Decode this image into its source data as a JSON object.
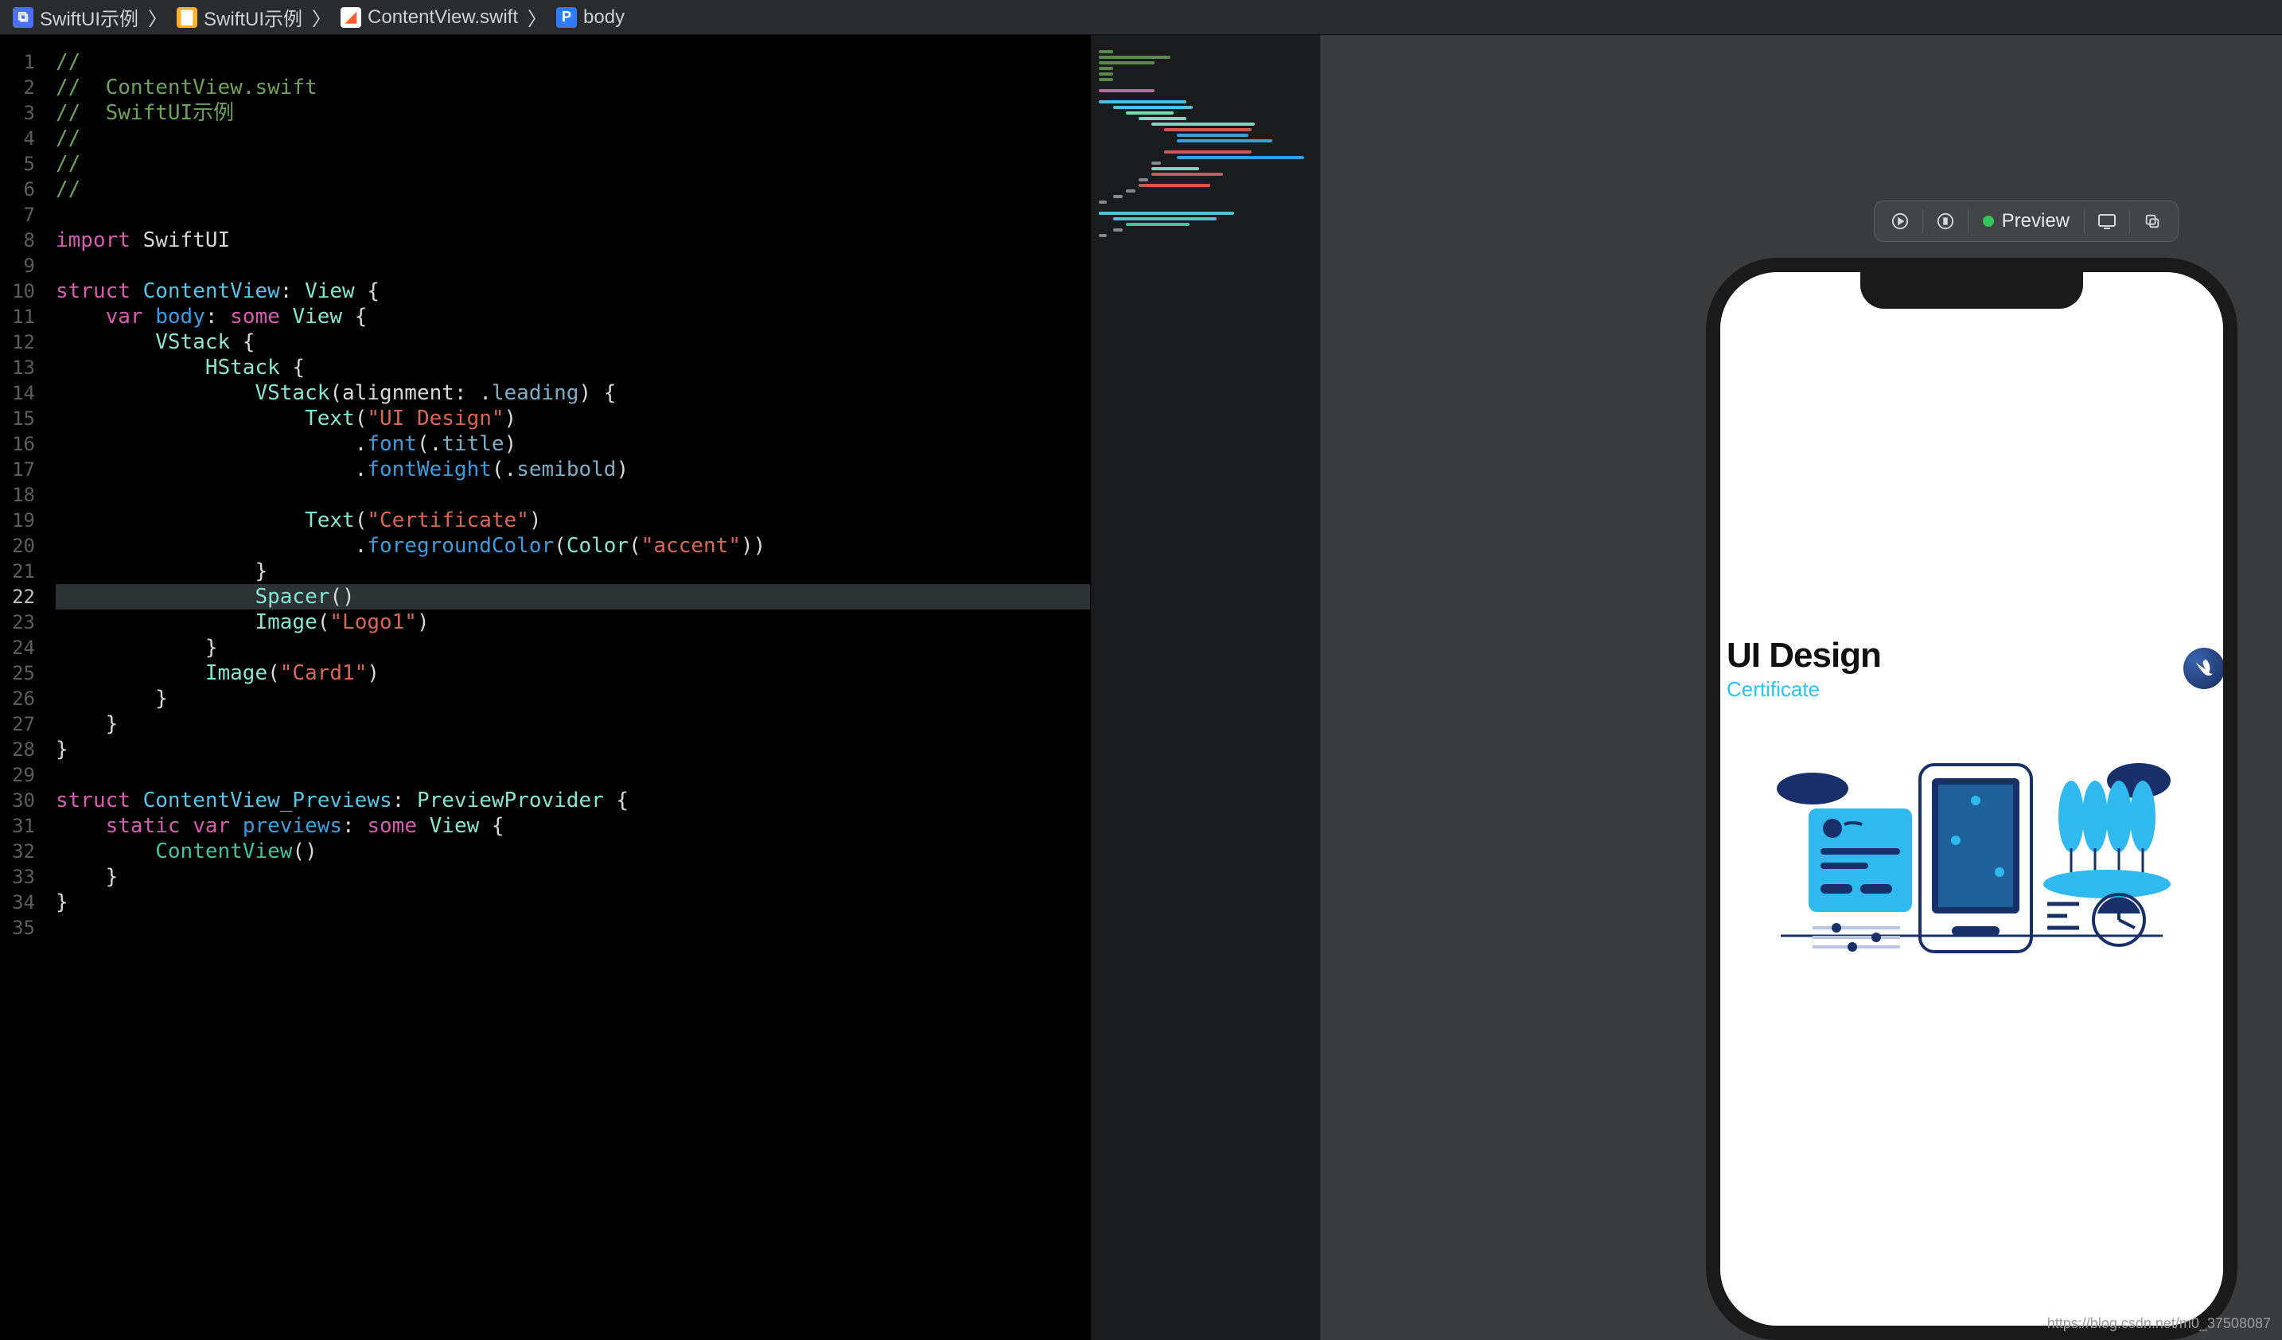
{
  "breadcrumb": {
    "project": "SwiftUI示例",
    "folder": "SwiftUI示例",
    "file": "ContentView.swift",
    "symbol": "body"
  },
  "editor": {
    "highlighted_line": 22,
    "lines": [
      {
        "n": 1,
        "seg": [
          {
            "c": "c-comment",
            "t": "//"
          }
        ]
      },
      {
        "n": 2,
        "seg": [
          {
            "c": "c-comment",
            "t": "//  ContentView.swift"
          }
        ]
      },
      {
        "n": 3,
        "seg": [
          {
            "c": "c-comment",
            "t": "//  SwiftUI示例"
          }
        ]
      },
      {
        "n": 4,
        "seg": [
          {
            "c": "c-comment",
            "t": "//"
          }
        ]
      },
      {
        "n": 5,
        "seg": [
          {
            "c": "c-comment",
            "t": "//"
          }
        ]
      },
      {
        "n": 6,
        "seg": [
          {
            "c": "c-comment",
            "t": "//"
          }
        ]
      },
      {
        "n": 7,
        "seg": []
      },
      {
        "n": 8,
        "seg": [
          {
            "c": "c-key",
            "t": "import "
          },
          {
            "c": "",
            "t": "SwiftUI"
          }
        ]
      },
      {
        "n": 9,
        "seg": []
      },
      {
        "n": 10,
        "seg": [
          {
            "c": "c-key",
            "t": "struct "
          },
          {
            "c": "c-type",
            "t": "ContentView"
          },
          {
            "c": "",
            "t": ": "
          },
          {
            "c": "c-type2",
            "t": "View"
          },
          {
            "c": "",
            "t": " {"
          }
        ]
      },
      {
        "n": 11,
        "seg": [
          {
            "c": "",
            "t": "    "
          },
          {
            "c": "c-key",
            "t": "var "
          },
          {
            "c": "c-member",
            "t": "body"
          },
          {
            "c": "",
            "t": ": "
          },
          {
            "c": "c-key",
            "t": "some "
          },
          {
            "c": "c-type2",
            "t": "View"
          },
          {
            "c": "",
            "t": " {"
          }
        ]
      },
      {
        "n": 12,
        "seg": [
          {
            "c": "",
            "t": "        "
          },
          {
            "c": "c-type2",
            "t": "VStack"
          },
          {
            "c": "",
            "t": " {"
          }
        ]
      },
      {
        "n": 13,
        "seg": [
          {
            "c": "",
            "t": "            "
          },
          {
            "c": "c-type2",
            "t": "HStack"
          },
          {
            "c": "",
            "t": " {"
          }
        ]
      },
      {
        "n": 14,
        "seg": [
          {
            "c": "",
            "t": "                "
          },
          {
            "c": "c-type2",
            "t": "VStack"
          },
          {
            "c": "",
            "t": "("
          },
          {
            "c": "",
            "t": "alignment: ."
          },
          {
            "c": "c-enum",
            "t": "leading"
          },
          {
            "c": "",
            "t": ") {"
          }
        ]
      },
      {
        "n": 15,
        "seg": [
          {
            "c": "",
            "t": "                    "
          },
          {
            "c": "c-type2",
            "t": "Text"
          },
          {
            "c": "",
            "t": "("
          },
          {
            "c": "c-string",
            "t": "\"UI Design\""
          },
          {
            "c": "",
            "t": ")"
          }
        ]
      },
      {
        "n": 16,
        "seg": [
          {
            "c": "",
            "t": "                        ."
          },
          {
            "c": "c-member",
            "t": "font"
          },
          {
            "c": "",
            "t": "(."
          },
          {
            "c": "c-enum",
            "t": "title"
          },
          {
            "c": "",
            "t": ")"
          }
        ]
      },
      {
        "n": 17,
        "seg": [
          {
            "c": "",
            "t": "                        ."
          },
          {
            "c": "c-member",
            "t": "fontWeight"
          },
          {
            "c": "",
            "t": "(."
          },
          {
            "c": "c-enum",
            "t": "semibold"
          },
          {
            "c": "",
            "t": ")"
          }
        ]
      },
      {
        "n": 18,
        "seg": []
      },
      {
        "n": 19,
        "seg": [
          {
            "c": "",
            "t": "                    "
          },
          {
            "c": "c-type2",
            "t": "Text"
          },
          {
            "c": "",
            "t": "("
          },
          {
            "c": "c-string",
            "t": "\"Certificate\""
          },
          {
            "c": "",
            "t": ")"
          }
        ]
      },
      {
        "n": 20,
        "seg": [
          {
            "c": "",
            "t": "                        ."
          },
          {
            "c": "c-member",
            "t": "foregroundColor"
          },
          {
            "c": "",
            "t": "("
          },
          {
            "c": "c-type2",
            "t": "Color"
          },
          {
            "c": "",
            "t": "("
          },
          {
            "c": "c-string",
            "t": "\"accent\""
          },
          {
            "c": "",
            "t": "))"
          }
        ]
      },
      {
        "n": 21,
        "seg": [
          {
            "c": "",
            "t": "                }"
          }
        ]
      },
      {
        "n": 22,
        "seg": [
          {
            "c": "",
            "t": "                "
          },
          {
            "c": "c-type2",
            "t": "Spacer"
          },
          {
            "c": "",
            "t": "()"
          }
        ]
      },
      {
        "n": 23,
        "seg": [
          {
            "c": "",
            "t": "                "
          },
          {
            "c": "c-type2",
            "t": "Image"
          },
          {
            "c": "",
            "t": "("
          },
          {
            "c": "c-string",
            "t": "\"Logo1\""
          },
          {
            "c": "",
            "t": ")"
          }
        ]
      },
      {
        "n": 24,
        "seg": [
          {
            "c": "",
            "t": "            }"
          }
        ]
      },
      {
        "n": 25,
        "seg": [
          {
            "c": "",
            "t": "            "
          },
          {
            "c": "c-type2",
            "t": "Image"
          },
          {
            "c": "",
            "t": "("
          },
          {
            "c": "c-string",
            "t": "\"Card1\""
          },
          {
            "c": "",
            "t": ")"
          }
        ]
      },
      {
        "n": 26,
        "seg": [
          {
            "c": "",
            "t": "        }"
          }
        ]
      },
      {
        "n": 27,
        "seg": [
          {
            "c": "",
            "t": "    }"
          }
        ]
      },
      {
        "n": 28,
        "seg": [
          {
            "c": "",
            "t": "}"
          }
        ]
      },
      {
        "n": 29,
        "seg": []
      },
      {
        "n": 30,
        "seg": [
          {
            "c": "c-key",
            "t": "struct "
          },
          {
            "c": "c-type",
            "t": "ContentView_Previews"
          },
          {
            "c": "",
            "t": ": "
          },
          {
            "c": "c-type2",
            "t": "PreviewProvider"
          },
          {
            "c": "",
            "t": " {"
          }
        ]
      },
      {
        "n": 31,
        "seg": [
          {
            "c": "",
            "t": "    "
          },
          {
            "c": "c-key",
            "t": "static var "
          },
          {
            "c": "c-member",
            "t": "previews"
          },
          {
            "c": "",
            "t": ": "
          },
          {
            "c": "c-key",
            "t": "some "
          },
          {
            "c": "c-type2",
            "t": "View"
          },
          {
            "c": "",
            "t": " {"
          }
        ]
      },
      {
        "n": 32,
        "seg": [
          {
            "c": "",
            "t": "        "
          },
          {
            "c": "c-id",
            "t": "ContentView"
          },
          {
            "c": "",
            "t": "()"
          }
        ]
      },
      {
        "n": 33,
        "seg": [
          {
            "c": "",
            "t": "    }"
          }
        ]
      },
      {
        "n": 34,
        "seg": [
          {
            "c": "",
            "t": "}"
          }
        ]
      },
      {
        "n": 35,
        "seg": []
      }
    ]
  },
  "toolbar": {
    "preview_label": "Preview"
  },
  "preview": {
    "title": "UI Design",
    "subtitle": "Certificate"
  },
  "minimap": [
    {
      "w": 18,
      "l": 0,
      "c": "#5a8a52"
    },
    {
      "w": 90,
      "l": 0,
      "c": "#5a8a52"
    },
    {
      "w": 70,
      "l": 0,
      "c": "#5a8a52"
    },
    {
      "w": 18,
      "l": 0,
      "c": "#5a8a52"
    },
    {
      "w": 18,
      "l": 0,
      "c": "#5a8a52"
    },
    {
      "w": 18,
      "l": 0,
      "c": "#5a8a52"
    },
    {
      "w": 0,
      "l": 0,
      "c": "transparent"
    },
    {
      "w": 70,
      "l": 0,
      "c": "#bd68a4"
    },
    {
      "w": 0,
      "l": 0,
      "c": "transparent"
    },
    {
      "w": 110,
      "l": 0,
      "c": "#55bfe0"
    },
    {
      "w": 100,
      "l": 18,
      "c": "#55bfe0"
    },
    {
      "w": 60,
      "l": 34,
      "c": "#7dd6c0"
    },
    {
      "w": 60,
      "l": 50,
      "c": "#7dd6c0"
    },
    {
      "w": 130,
      "l": 66,
      "c": "#7dd6c0"
    },
    {
      "w": 110,
      "l": 82,
      "c": "#c45d4f"
    },
    {
      "w": 90,
      "l": 98,
      "c": "#3a9ddf"
    },
    {
      "w": 120,
      "l": 98,
      "c": "#3a9ddf"
    },
    {
      "w": 0,
      "l": 0,
      "c": "transparent"
    },
    {
      "w": 110,
      "l": 82,
      "c": "#c45d4f"
    },
    {
      "w": 160,
      "l": 98,
      "c": "#3a9ddf"
    },
    {
      "w": 12,
      "l": 66,
      "c": "#888"
    },
    {
      "w": 60,
      "l": 66,
      "c": "#7dd6c0"
    },
    {
      "w": 90,
      "l": 66,
      "c": "#c45d4f"
    },
    {
      "w": 12,
      "l": 50,
      "c": "#888"
    },
    {
      "w": 90,
      "l": 50,
      "c": "#c45d4f"
    },
    {
      "w": 12,
      "l": 34,
      "c": "#888"
    },
    {
      "w": 12,
      "l": 18,
      "c": "#888"
    },
    {
      "w": 10,
      "l": 0,
      "c": "#888"
    },
    {
      "w": 0,
      "l": 0,
      "c": "transparent"
    },
    {
      "w": 170,
      "l": 0,
      "c": "#55bfe0"
    },
    {
      "w": 130,
      "l": 18,
      "c": "#55bfe0"
    },
    {
      "w": 80,
      "l": 34,
      "c": "#40c4a0"
    },
    {
      "w": 12,
      "l": 18,
      "c": "#888"
    },
    {
      "w": 10,
      "l": 0,
      "c": "#888"
    }
  ],
  "watermark": "https://blog.csdn.net/m0_37508087"
}
